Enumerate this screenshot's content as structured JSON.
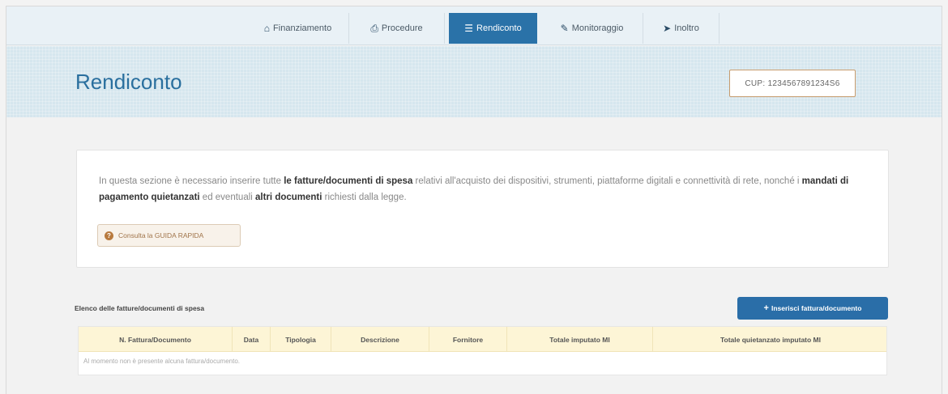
{
  "nav": {
    "items": [
      {
        "label": "Finanziamento",
        "icon": "home-icon",
        "glyph": "⌂",
        "active": false
      },
      {
        "label": "Procedure",
        "icon": "procedure-icon",
        "glyph": "⎙",
        "active": false
      },
      {
        "label": "Rendiconto",
        "icon": "report-icon",
        "glyph": "☰",
        "active": true
      },
      {
        "label": "Monitoraggio",
        "icon": "edit-icon",
        "glyph": "✎",
        "active": false
      },
      {
        "label": "Inoltro",
        "icon": "send-icon",
        "glyph": "➤",
        "active": false
      }
    ]
  },
  "header": {
    "title": "Rendiconto",
    "cup": "CUP: 1234567891234S6"
  },
  "info": {
    "t1": "In questa sezione è necessario inserire tutte ",
    "b1": "le fatture/documenti di spesa",
    "t2": " relativi all'acquisto dei dispositivi, strumenti, piattaforme digitali e connettività di rete, nonché i ",
    "b2": "mandati di pagamento quietanzati",
    "t3": " ed eventuali ",
    "b3": "altri documenti",
    "t4": " richiesti dalla legge.",
    "guide_label": "Consulta la GUIDA RAPIDA",
    "guide_icon_glyph": "?"
  },
  "list": {
    "title": "Elenco delle fatture/documenti di spesa",
    "add_label": "Inserisci fattura/documento",
    "add_glyph": "+",
    "columns": [
      "N. Fattura/Documento",
      "Data",
      "Tipologia",
      "Descrizione",
      "Fornitore",
      "Totale imputato MI",
      "Totale quietanzato imputato MI"
    ],
    "empty_message": "Al momento non è presente alcuna fattura/documento."
  },
  "colors": {
    "accent": "#2a72a8",
    "title": "#2a6f9e",
    "table_header": "#fdf5d6",
    "cup_border": "#c69b6d"
  }
}
